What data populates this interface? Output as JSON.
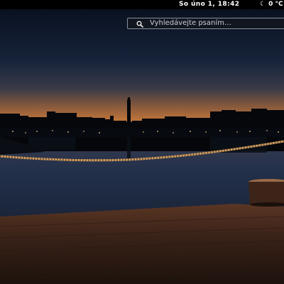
{
  "top_bar": {
    "clock": "So úno  1, 18:42",
    "status_icon": "moon-icon",
    "status_text": "0 °C"
  },
  "search": {
    "placeholder": "Vyhledávejte psaním…",
    "icon": "search-icon"
  },
  "wallpaper": {
    "description_icon": "harbor-dusk-wallpaper",
    "colors": {
      "sky_top": "#0b1220",
      "sky_horizon": "#c9743a",
      "water": "#1a2437",
      "deck": "#3a2418"
    }
  }
}
